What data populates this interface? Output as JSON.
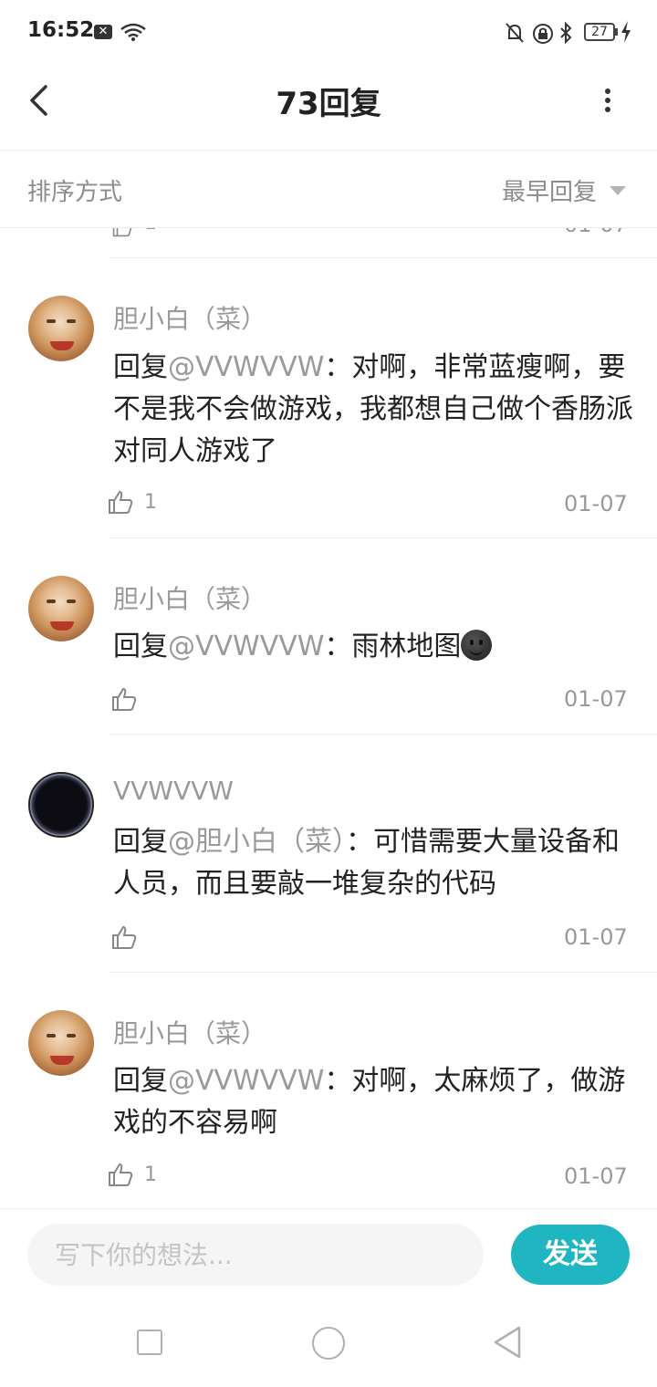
{
  "status_bar": {
    "time": "16:52",
    "notification_icon": "x-icon",
    "battery": "27",
    "icons": [
      "wifi-icon",
      "mute-bell-icon",
      "lock-icon",
      "bluetooth-icon",
      "battery-icon",
      "charging-bolt-icon"
    ]
  },
  "header": {
    "title": "73回复",
    "back_icon": "chevron-left-icon",
    "more_icon": "more-vertical-icon"
  },
  "sort": {
    "label": "排序方式",
    "value": "最早回复"
  },
  "previous_item": {
    "like_count": "1",
    "date": "01-07"
  },
  "comments": [
    {
      "username": "胆小白（菜）",
      "reply_prefix": "回复",
      "mention": "@VVWVVW",
      "text": "：对啊，非常蓝瘦啊，要不是我不会做游戏，我都想自己做个香肠派对同人游戏了",
      "like_count": "1",
      "date": "01-07"
    },
    {
      "username": "胆小白（菜）",
      "reply_prefix": "回复",
      "mention": "@VVWVVW",
      "text": "：雨林地图",
      "emoji": "smile-emoji",
      "like_count": "",
      "date": "01-07"
    },
    {
      "username": "VVWVVW",
      "reply_prefix": "回复",
      "mention": "@胆小白（菜）",
      "text": "：可惜需要大量设备和人员，而且要敲一堆复杂的代码",
      "like_count": "",
      "date": "01-07"
    },
    {
      "username": "胆小白（菜）",
      "reply_prefix": "回复",
      "mention": "@VVWVVW",
      "text": "：对啊，太麻烦了，做游戏的不容易啊",
      "like_count": "1",
      "date": "01-07"
    }
  ],
  "composer": {
    "placeholder": "写下你的想法...",
    "send_label": "发送",
    "accent_color": "#1fb6c1"
  },
  "system_nav": {
    "icons": [
      "recent-apps-icon",
      "home-icon",
      "back-icon"
    ]
  }
}
